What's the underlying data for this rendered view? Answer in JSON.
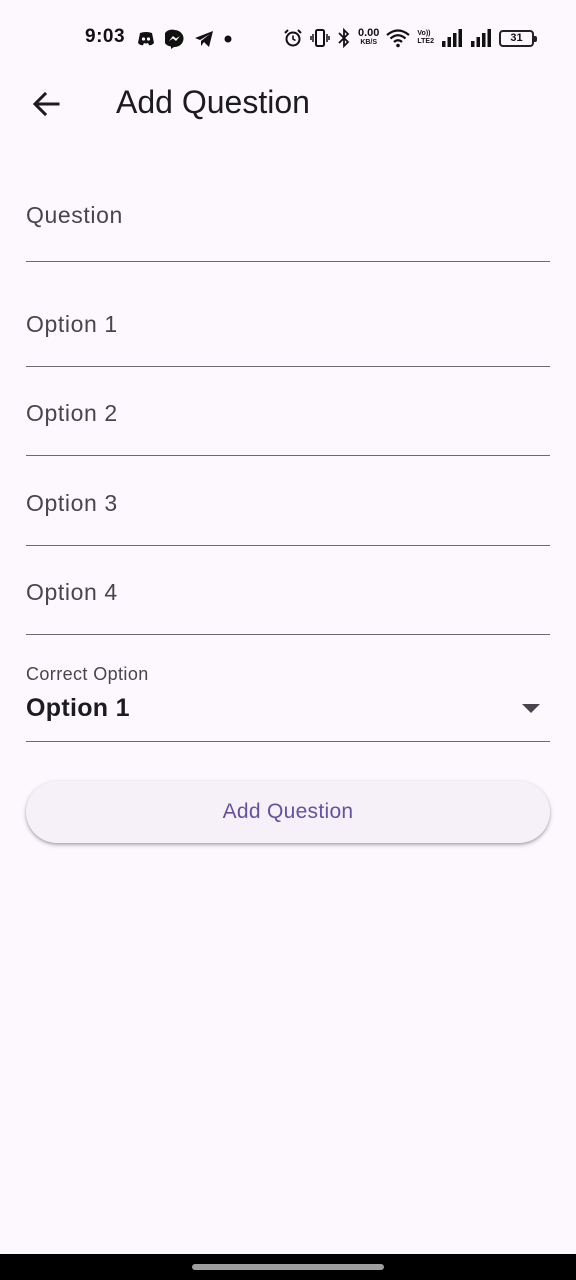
{
  "status_bar": {
    "time": "9:03",
    "net_speed_value": "0.00",
    "net_speed_unit": "KB/S",
    "volte_top": "Vo))",
    "volte_bottom": "LTE2",
    "battery": "31",
    "left_icons": [
      "discord-icon",
      "messenger-icon",
      "telegram-icon",
      "dot-icon"
    ],
    "right_icons": [
      "alarm-icon",
      "vibrate-icon",
      "bluetooth-icon",
      "wifi-icon",
      "signal-icon",
      "signal-icon",
      "battery-icon"
    ]
  },
  "app_bar": {
    "back_icon": "arrow-back-icon",
    "title": "Add Question"
  },
  "form": {
    "question_hint": "Question",
    "option1_hint": "Option 1",
    "option2_hint": "Option 2",
    "option3_hint": "Option 3",
    "option4_hint": "Option 4",
    "correct_option_label": "Correct Option",
    "correct_option_value": "Option 1",
    "submit_label": "Add Question"
  },
  "colors": {
    "background": "#fdf7fe",
    "accent": "#6750a4",
    "text": "#1c1b1f",
    "hint": "#49454f"
  }
}
